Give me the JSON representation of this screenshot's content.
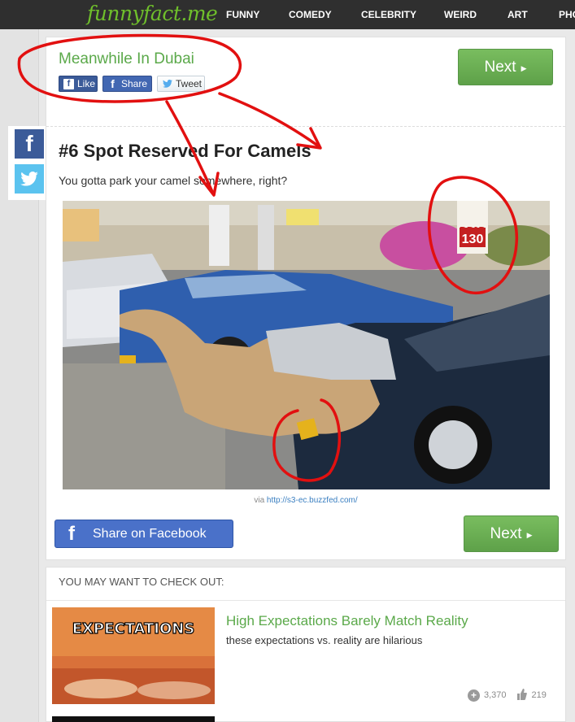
{
  "nav": {
    "logo": "funnyfact.me",
    "items": [
      "FUNNY",
      "COMEDY",
      "CELEBRITY",
      "WEIRD",
      "ART",
      "PHO"
    ]
  },
  "post": {
    "headline": "Meanwhile In Dubai",
    "like_label": "Like",
    "share_label": "Share",
    "tweet_label": "Tweet",
    "next_label": "Next",
    "item_title": "#6 Spot Reserved For Camels",
    "item_desc": "You gotta park your camel somewhere, right?",
    "via_prefix": "via ",
    "via_link": "http://s3-ec.buzzfed.com/",
    "share_fb_label": "Share on Facebook",
    "photo_sign": "130",
    "photo_sign_top": "הנחה"
  },
  "more": {
    "heading": "YOU MAY WANT TO CHECK OUT:",
    "items": [
      {
        "thumb_text": "EXPECTATIONS",
        "title": "High Expectations Barely Match Reality",
        "desc": "these expectations vs. reality are hilarious",
        "views": "3,370",
        "likes": "219"
      }
    ]
  },
  "colors": {
    "accent_green": "#5ba94a",
    "nav_bg": "#2f2f2f",
    "facebook": "#3b5b99",
    "twitter": "#5bc3ef",
    "annotation_red": "#e21010"
  },
  "icons": [
    "facebook-icon",
    "twitter-icon",
    "plus-circle-icon",
    "thumbs-up-icon",
    "play-arrow-icon"
  ]
}
